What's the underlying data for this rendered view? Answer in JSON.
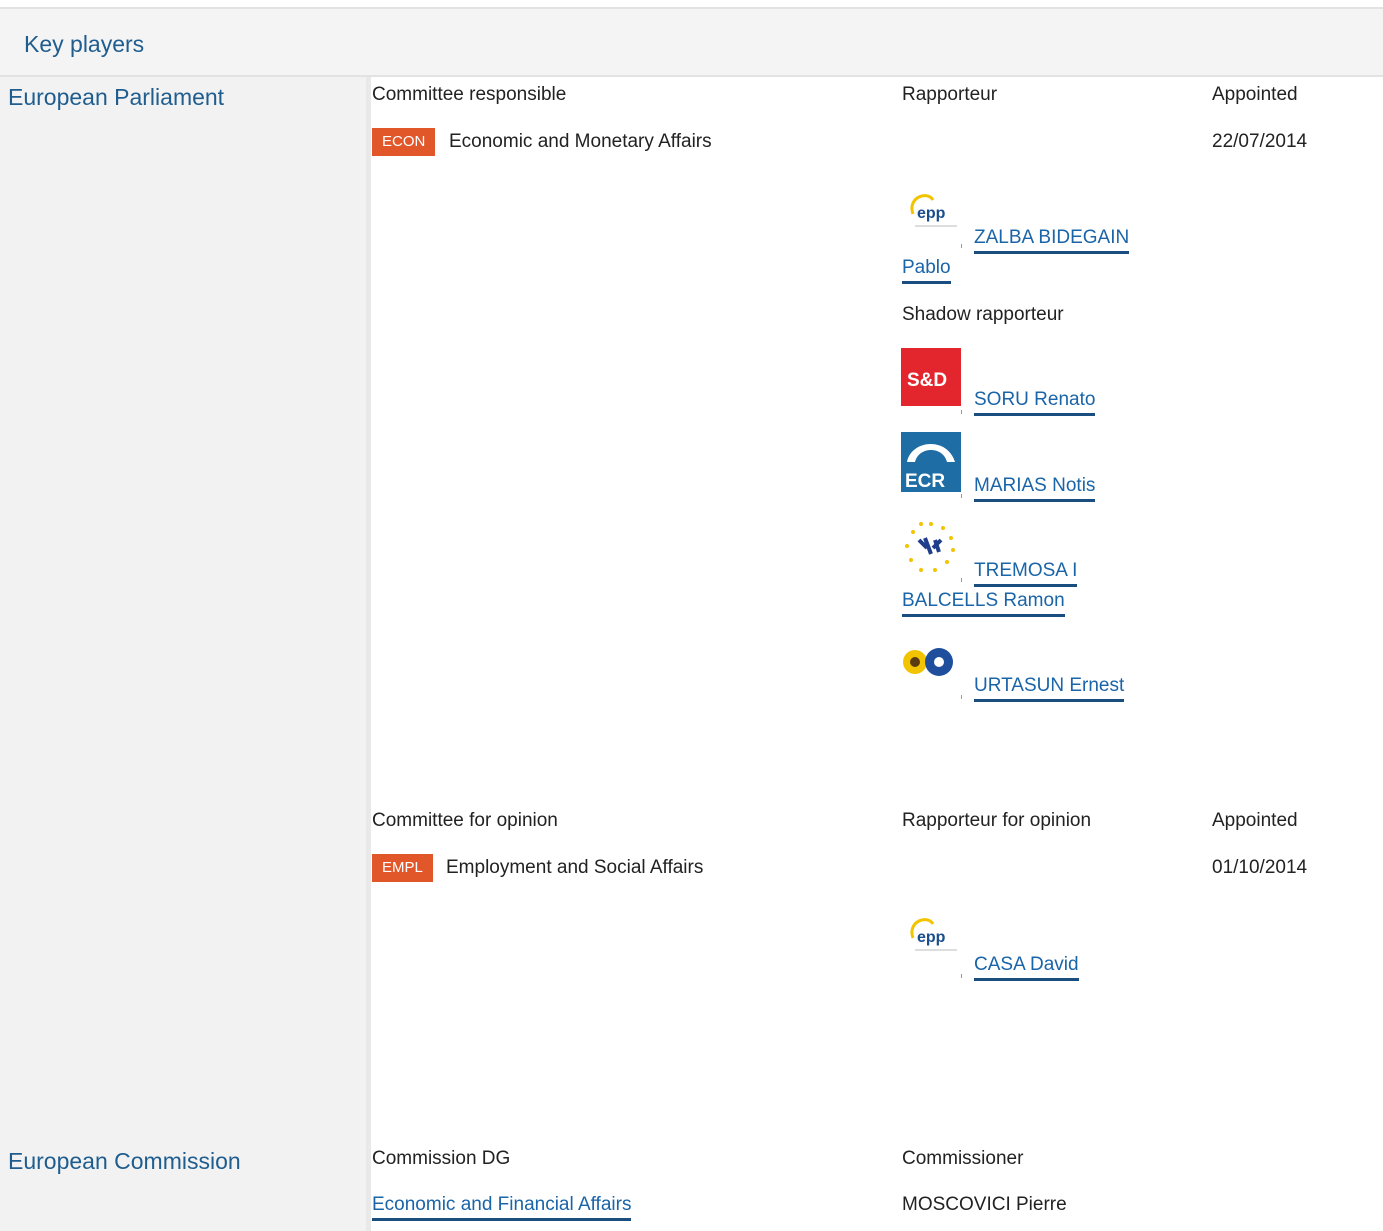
{
  "header": {
    "title": "Key players"
  },
  "parliament": {
    "label": "European Parliament",
    "responsible": {
      "col_committee": "Committee responsible",
      "col_rapporteur": "Rapporteur",
      "col_appointed": "Appointed",
      "committee_code": "ECON",
      "committee_name": "Economic and Monetary Affairs",
      "appointed": "22/07/2014",
      "rapporteur": {
        "group": "epp",
        "name_line1": "ZALBA BIDEGAIN",
        "name_line2": "Pablo"
      },
      "shadow_label": "Shadow rapporteur",
      "shadows": [
        {
          "group": "S&D",
          "name": "SORU Renato"
        },
        {
          "group": "ECR",
          "name": "MARIAS Notis"
        },
        {
          "group": "ALDE",
          "name_line1": "TREMOSA I",
          "name_line2": "BALCELLS Ramon"
        },
        {
          "group": "Greens/EFA",
          "name": "URTASUN Ernest"
        }
      ]
    },
    "opinion": {
      "col_committee": "Committee for opinion",
      "col_rapporteur": "Rapporteur for opinion",
      "col_appointed": "Appointed",
      "committee_code": "EMPL",
      "committee_name": "Employment and Social Affairs",
      "appointed": "01/10/2014",
      "rapporteur": {
        "group": "epp",
        "name": "CASA David"
      }
    }
  },
  "commission": {
    "label": "European Commission",
    "col_dg": "Commission DG",
    "col_commissioner": "Commissioner",
    "dg": "Economic and Financial Affairs",
    "commissioner": "MOSCOVICI Pierre"
  },
  "colors": {
    "badge": "#e1572a",
    "link": "#1a64a8",
    "institution": "#1f5d8f"
  }
}
